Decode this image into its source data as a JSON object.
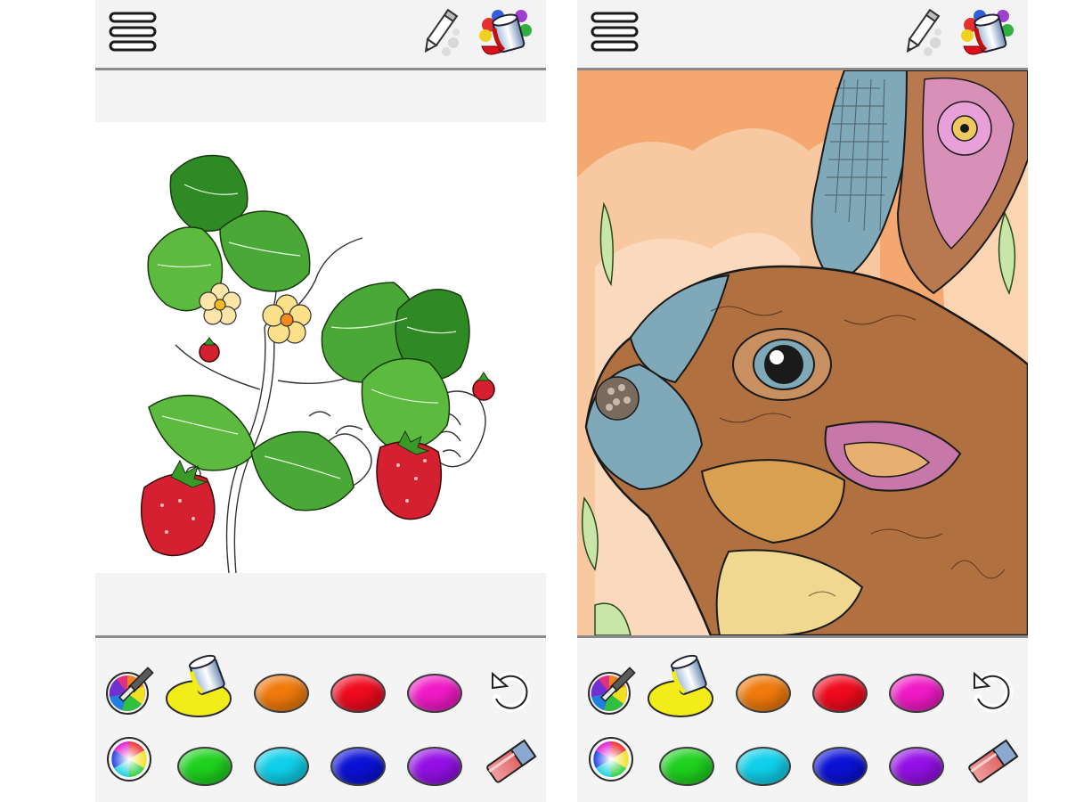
{
  "screens": [
    {
      "id": "left",
      "subject": "strawberry",
      "toolbar": {
        "menu_icon": "hamburger-menu-icon",
        "pencil_icon": "pencil-icon",
        "bucket_icon": "paint-bucket-icon"
      }
    },
    {
      "id": "right",
      "subject": "rabbit",
      "toolbar": {
        "menu_icon": "hamburger-menu-icon",
        "pencil_icon": "pencil-icon",
        "bucket_icon": "paint-bucket-icon"
      }
    }
  ],
  "palette": {
    "row1": [
      {
        "name": "color-picker-dropper",
        "icon": "eyedropper-icon"
      },
      {
        "name": "selected-color",
        "color": "#f2ec1a",
        "icon": "paint-bucket-icon",
        "selected": true
      },
      {
        "name": "orange",
        "color": "#f07a0c"
      },
      {
        "name": "red",
        "color": "#f00a1e"
      },
      {
        "name": "magenta",
        "color": "#f01ac6"
      },
      {
        "name": "undo",
        "icon": "undo-icon"
      }
    ],
    "row2": [
      {
        "name": "color-wheel",
        "icon": "color-wheel-icon"
      },
      {
        "name": "green",
        "color": "#1ed21e"
      },
      {
        "name": "cyan",
        "color": "#10d0ea"
      },
      {
        "name": "blue",
        "color": "#0a12d6"
      },
      {
        "name": "violet",
        "color": "#9410e6"
      },
      {
        "name": "eraser",
        "icon": "eraser-icon"
      }
    ]
  }
}
